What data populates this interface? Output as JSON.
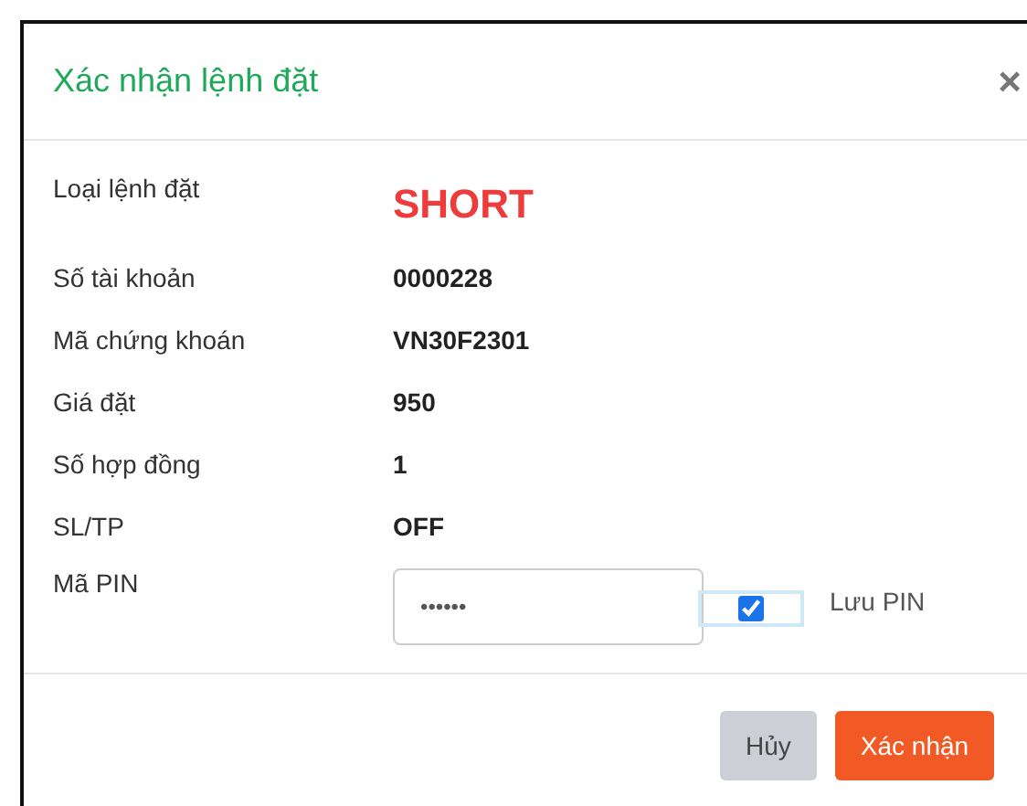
{
  "dialog": {
    "title": "Xác nhận lệnh đặt",
    "close": "×"
  },
  "rows": [
    {
      "label": "Loại lệnh đặt",
      "value": "SHORT",
      "kind": "highlight"
    },
    {
      "label": "Số tài khoản",
      "value": "0000228",
      "kind": "text"
    },
    {
      "label": "Mã chứng khoán",
      "value": "VN30F2301",
      "kind": "text"
    },
    {
      "label": "Giá đặt",
      "value": "950",
      "kind": "text"
    },
    {
      "label": "Số hợp đồng",
      "value": "1",
      "kind": "text"
    },
    {
      "label": "SL/TP",
      "value": "OFF",
      "kind": "text"
    }
  ],
  "pin": {
    "label": "Mã PIN",
    "value": "••••••",
    "save_label": "Lưu PIN",
    "save_checked": true
  },
  "buttons": [
    {
      "label": "Hủy",
      "kind": "secondary"
    },
    {
      "label": "Xác nhận",
      "kind": "primary"
    }
  ]
}
